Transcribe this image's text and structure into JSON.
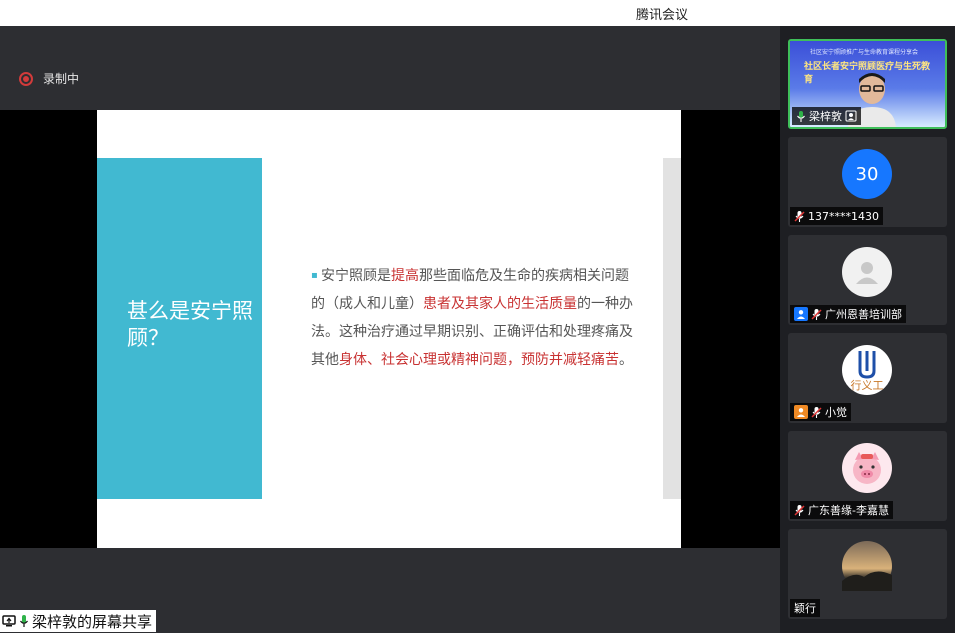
{
  "window": {
    "title": "腾讯会议"
  },
  "recording": {
    "label": "录制中"
  },
  "slide": {
    "title": "甚么是安宁照顾？",
    "segments": [
      {
        "text": "安宁照顾是",
        "emph": false
      },
      {
        "text": "提高",
        "emph": true
      },
      {
        "text": "那些面临危及生命的疾病相关问题的（成人和儿童）",
        "emph": false
      },
      {
        "text": "患者及其家人的生活质量",
        "emph": true
      },
      {
        "text": "的一种办法。这种治疗通过早期识别、正确评估和处理疼痛及其他",
        "emph": false
      },
      {
        "text": "身体、社会心理或精神问题，预防并减轻痛苦",
        "emph": true
      },
      {
        "text": "。",
        "emph": false
      }
    ]
  },
  "share": {
    "label": "梁梓敦的屏幕共享"
  },
  "participants": [
    {
      "name": "梁梓敦",
      "kind": "video",
      "banner_small": "社区安宁照顾推广与生命教育课程分享会",
      "banner_title": "社区长者安宁照顾医疗与生死教育"
    },
    {
      "name": "137****1430",
      "kind": "number",
      "avatar_text": "30",
      "avatar_color": "#1677ff"
    },
    {
      "name": "广州恩善培训部",
      "kind": "avatar",
      "avatar_text": ""
    },
    {
      "name": "小觉",
      "kind": "logo",
      "avatar_text": "行义工"
    },
    {
      "name": "广东善缘-李嘉慧",
      "kind": "pig",
      "avatar_text": ""
    },
    {
      "name": "颖行",
      "kind": "photo",
      "avatar_text": ""
    }
  ],
  "colors": {
    "accent": "#41b9d1",
    "emphasis": "#c83232",
    "active_border": "#3fbf5a",
    "record": "#d23b3b"
  }
}
